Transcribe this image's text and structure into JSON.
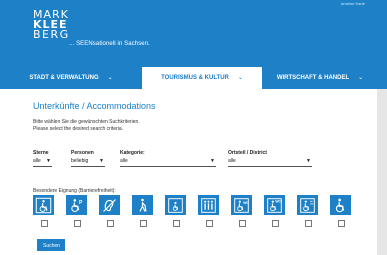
{
  "brand": {
    "logo_lines": [
      "MARK",
      "KLEE",
      "BERG"
    ],
    "tagline": "... SEENsationell in Sachsen.",
    "top_links": "Anreise   Karte"
  },
  "nav": {
    "items": [
      {
        "label": "STADT & VERWALTUNG",
        "active": false
      },
      {
        "label": "TOURISMUS & KULTUR",
        "active": true
      },
      {
        "label": "WIRTSCHAFT & HANDEL",
        "active": false
      }
    ],
    "chevron": "⌄"
  },
  "page": {
    "title": "Unterkünfte / Accommodations",
    "intro_line1": "Bitte wählen Sie die gewünschten Suchkriterien.",
    "intro_line2": "Please select the desired search criteria."
  },
  "filters": {
    "sterne": {
      "label": "Sterne",
      "value": "alle"
    },
    "personen": {
      "label": "Personen",
      "value": "beliebig"
    },
    "kategorie": {
      "label": "Kategorie:",
      "value": "alle"
    },
    "ortsteil": {
      "label": "Ortsteil / District",
      "value": "alle"
    }
  },
  "accessibility": {
    "label": "Besondere Eignung (Barrierefreiheit):",
    "icons": [
      "wheelchair-info-icon",
      "wheelchair-parking-icon",
      "hearing-impaired-icon",
      "walking-aid-icon",
      "elevator-icon",
      "family-accessible-icon",
      "wheelchair-wc-icon",
      "wheelchair-wc-icon",
      "wheelchair-shower-icon",
      "wheelchair-icon"
    ]
  },
  "search_button": "Suchen",
  "colors": {
    "brand_blue": "#1e80c7"
  }
}
